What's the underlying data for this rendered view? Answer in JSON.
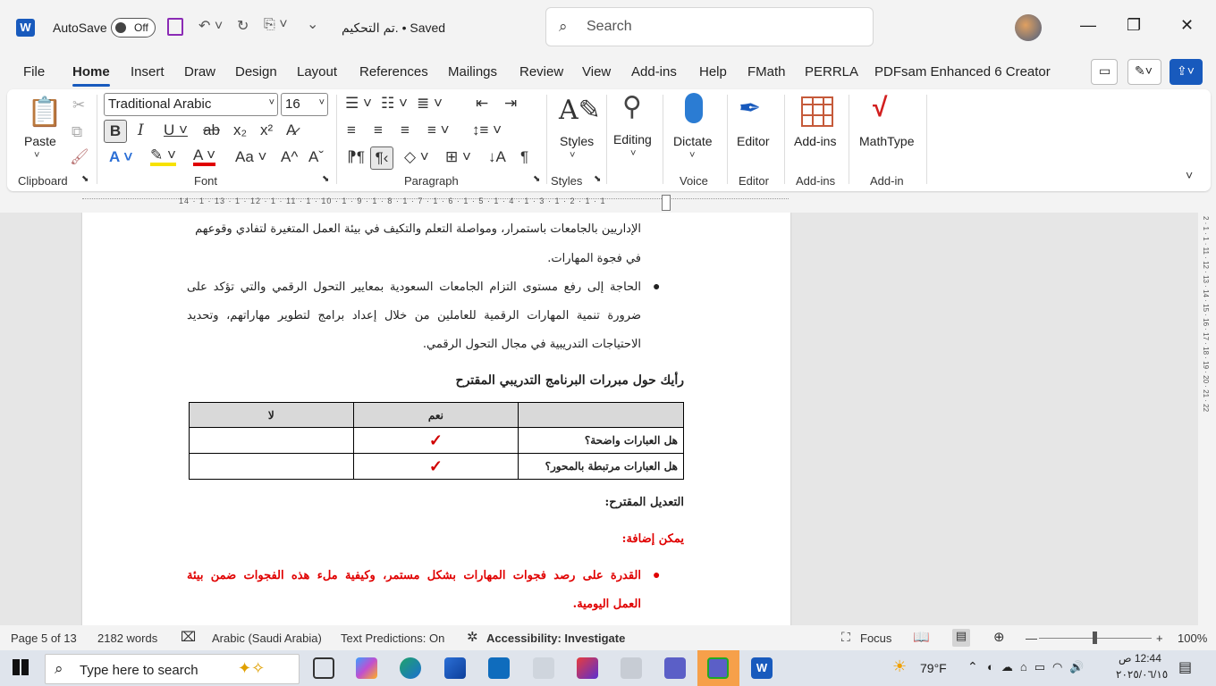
{
  "title_bar": {
    "app_logo": "W",
    "autosave_label": "AutoSave",
    "autosave_state": "Off",
    "doc_title": "تم التحكيم. • Saved",
    "search_placeholder": "Search"
  },
  "tabs": [
    "File",
    "Home",
    "Insert",
    "Draw",
    "Design",
    "Layout",
    "References",
    "Mailings",
    "Review",
    "View",
    "Add-ins",
    "Help",
    "FMath",
    "PERRLA",
    "PDFsam Enhanced 6 Creator"
  ],
  "active_tab": "Home",
  "ribbon": {
    "clipboard": {
      "paste": "Paste",
      "label": "Clipboard"
    },
    "font": {
      "name": "Traditional Arabic",
      "size": "16",
      "label": "Font"
    },
    "paragraph": {
      "label": "Paragraph"
    },
    "styles": {
      "button": "Styles",
      "label": "Styles"
    },
    "editing": {
      "button": "Editing"
    },
    "voice": {
      "button": "Dictate",
      "label": "Voice"
    },
    "editor": {
      "button": "Editor",
      "label": "Editor"
    },
    "addins": {
      "button": "Add-ins",
      "label": "Add-ins"
    },
    "mathtype": {
      "button": "MathType",
      "label": "Add-in"
    }
  },
  "ruler": "14 · 1 · 13 · 1 · 12 · 1 · 11 · 1 · 10 · 1 · 9 · 1 · 8 · 1 · 7 · 1 · 6 · 1 · 5 · 1 · 4 · 1 · 3 · 1 · 2 · 1 · 1",
  "document": {
    "line1": "الإداريين بالجامعات باستمرار، ومواصلة التعلم والتكيف في بيئة العمل المتغيرة لتفادي وقوعهم",
    "line2": "في فجوة المهارات.",
    "bullet2_line1": "الحاجة إلى رفع مستوى التزام الجامعات السعودية بمعايير التحول الرقمي والتي تؤكد على",
    "bullet2_line2": "ضرورة تنمية المهارات الرقمية للعاملين من خلال إعداد برامج لتطوير مهاراتهم، وتحديد",
    "bullet2_line3": "الاحتياجات التدريبية في مجال التحول الرقمي.",
    "heading": "رأيك حول مبررات البرنامج التدريبي المقترح",
    "table": {
      "headers": [
        "",
        "نعم",
        "لا"
      ],
      "rows": [
        {
          "q": "هل العبارات واضحة؟",
          "yes": "✓",
          "no": ""
        },
        {
          "q": "هل العبارات مرتبطة بالمحور؟",
          "yes": "✓",
          "no": ""
        }
      ]
    },
    "modification_label": "التعديل المقترح:",
    "can_add": "يمكن إضافة:",
    "red_bullet_line1": "القدرة على رصد فجوات المهارات بشكل مستمر، وكيفية ملء هذه الفجوات ضمن بيئة",
    "red_bullet_line2": "العمل اليومية."
  },
  "vruler": "2 · 1 · 1 · 11 · 12 · 13 · 14 · 15 · 16 · 17 · 18 · 19 · 20 · 21 · 22",
  "status": {
    "page": "Page 5 of 13",
    "words": "2182 words",
    "language": "Arabic (Saudi Arabia)",
    "predictions": "Text Predictions: On",
    "accessibility": "Accessibility: Investigate",
    "focus": "Focus",
    "zoom": "100%"
  },
  "taskbar": {
    "search_placeholder": "Type here to search",
    "weather": "79°F",
    "time": "12:44 ص",
    "date": "٢٠٢٥/٠٦/١٥"
  },
  "colors": {
    "accent": "#185abd",
    "red_text": "#e00000",
    "check": "#d00000"
  }
}
